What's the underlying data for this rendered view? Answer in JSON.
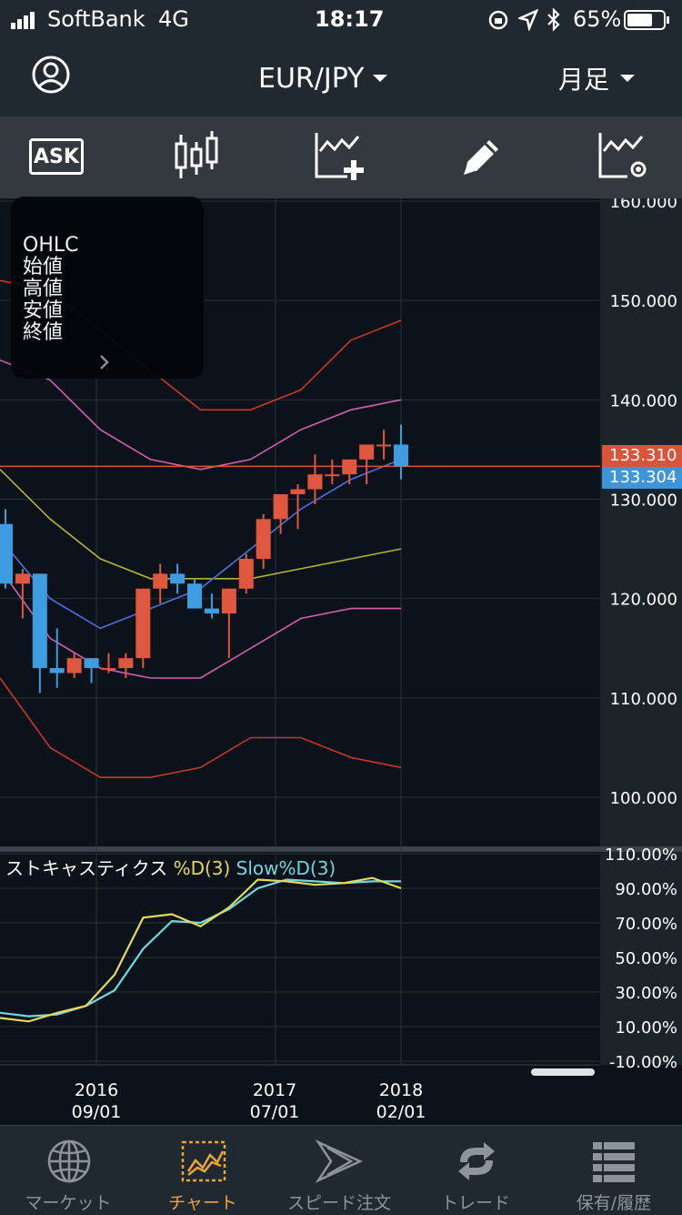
{
  "status": {
    "carrier": "SoftBank",
    "network": "4G",
    "time": "18:17",
    "battery": "65%"
  },
  "header": {
    "pair": "EUR/JPY",
    "period": "月足",
    "user_icon": "user-icon"
  },
  "toolbar": {
    "ask_label": "ASK",
    "icons": [
      "candlestick-icon",
      "add-indicator-icon",
      "pencil-icon",
      "indicator-settings-icon"
    ]
  },
  "ohlc_panel": {
    "title": "OHLC",
    "open": "始値",
    "high": "高値",
    "low": "安値",
    "close": "終値"
  },
  "price_axis": [
    "160.000",
    "150.000",
    "140.000",
    "130.000",
    "120.000",
    "110.000",
    "100.000"
  ],
  "price_tags": {
    "ask": "133.310",
    "bid": "133.304"
  },
  "stoch": {
    "title": "ストキャスティクス",
    "d_label": "%D(3)",
    "slowd_label": "Slow%D(3)",
    "axis": [
      "110.00%",
      "90.00%",
      "70.00%",
      "50.00%",
      "30.00%",
      "10.00%",
      "-10.00%"
    ]
  },
  "dates": [
    {
      "year": "2016",
      "md": "09/01"
    },
    {
      "year": "2017",
      "md": "07/01"
    },
    {
      "year": "2018",
      "md": "02/01"
    }
  ],
  "tabs": [
    {
      "label": "マーケット",
      "icon": "globe-icon"
    },
    {
      "label": "チャート",
      "icon": "chart-icon"
    },
    {
      "label": "スピード注文",
      "icon": "speed-order-icon"
    },
    {
      "label": "トレード",
      "icon": "trade-icon"
    },
    {
      "label": "保有/履歴",
      "icon": "history-icon"
    }
  ],
  "colors": {
    "up": "#e0573f",
    "down": "#3e9de0",
    "ask_tag": "#d9543a",
    "bid_tag": "#3e95d8",
    "accent": "#e8a53a",
    "stoch_d": "#e3d95a",
    "stoch_slow": "#6fd8e0"
  },
  "chart_data": {
    "type": "candlestick",
    "ylim": [
      100,
      160
    ],
    "candles": [
      {
        "o": 127.5,
        "h": 129,
        "l": 121,
        "c": 121.5
      },
      {
        "o": 121.5,
        "h": 123,
        "l": 118,
        "c": 122.5
      },
      {
        "o": 122.5,
        "h": 122.5,
        "l": 110.5,
        "c": 113
      },
      {
        "o": 113,
        "h": 117,
        "l": 111,
        "c": 112.5
      },
      {
        "o": 112.5,
        "h": 114.5,
        "l": 112,
        "c": 114
      },
      {
        "o": 114,
        "h": 114,
        "l": 111.5,
        "c": 113
      },
      {
        "o": 113,
        "h": 114.5,
        "l": 112.5,
        "c": 113
      },
      {
        "o": 113,
        "h": 114.5,
        "l": 112,
        "c": 114
      },
      {
        "o": 114,
        "h": 121,
        "l": 113,
        "c": 121
      },
      {
        "o": 121,
        "h": 123.5,
        "l": 119.5,
        "c": 122.5
      },
      {
        "o": 122.5,
        "h": 123.5,
        "l": 120.5,
        "c": 121.5
      },
      {
        "o": 121.5,
        "h": 122,
        "l": 119.5,
        "c": 119
      },
      {
        "o": 119,
        "h": 120.5,
        "l": 118,
        "c": 118.5
      },
      {
        "o": 118.5,
        "h": 121,
        "l": 114,
        "c": 121
      },
      {
        "o": 121,
        "h": 124.5,
        "l": 120.5,
        "c": 124
      },
      {
        "o": 124,
        "h": 128.5,
        "l": 123,
        "c": 128
      },
      {
        "o": 128,
        "h": 130.5,
        "l": 126.5,
        "c": 130.5
      },
      {
        "o": 130.5,
        "h": 131.5,
        "l": 127,
        "c": 131
      },
      {
        "o": 131,
        "h": 134.5,
        "l": 129.5,
        "c": 132.5
      },
      {
        "o": 132.5,
        "h": 134,
        "l": 131.5,
        "c": 132.5
      },
      {
        "o": 132.5,
        "h": 134,
        "l": 131.5,
        "c": 134
      },
      {
        "o": 134,
        "h": 135.5,
        "l": 131.5,
        "c": 135.5
      },
      {
        "o": 135.5,
        "h": 137,
        "l": 134,
        "c": 135.5
      },
      {
        "o": 135.5,
        "h": 137.5,
        "l": 132,
        "c": 133.3
      }
    ],
    "bands": {
      "outer_upper": [
        152,
        151,
        147,
        143,
        139,
        139,
        141,
        146,
        148
      ],
      "mid_upper": [
        144,
        142,
        137,
        134,
        133,
        134,
        137,
        139,
        140
      ],
      "center": [
        133,
        128,
        124,
        122,
        122,
        122,
        123,
        124,
        125
      ],
      "mid_lower": [
        123,
        116,
        113,
        112,
        112,
        115,
        118,
        119,
        119
      ],
      "outer_lower": [
        112,
        105,
        102,
        102,
        103,
        106,
        106,
        104,
        103
      ]
    },
    "stoch_d": [
      15,
      13,
      18,
      22,
      40,
      73,
      75,
      68,
      79,
      95,
      94,
      92,
      93,
      96,
      90
    ],
    "stoch_slow": [
      18,
      16,
      17,
      22,
      31,
      55,
      71,
      70,
      78,
      90,
      95,
      94,
      93,
      94,
      94
    ]
  }
}
